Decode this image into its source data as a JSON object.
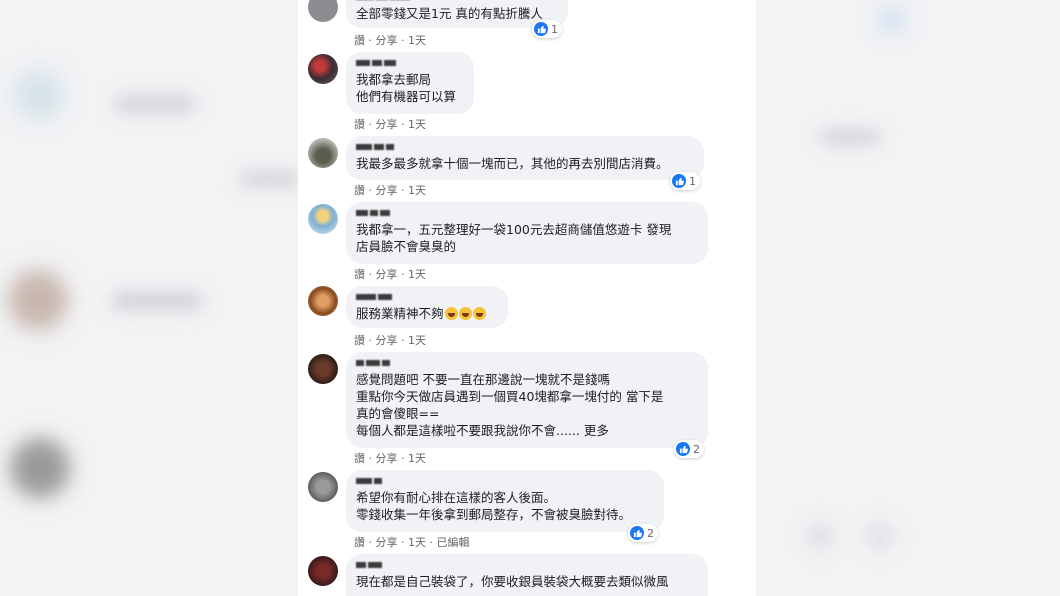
{
  "comments": [
    {
      "text": "全部零錢又是1元 真的有點折騰人",
      "meta": "讚 · 分享 · 1天",
      "reactions": "1"
    },
    {
      "text": "我都拿去郵局\n他們有機器可以算",
      "meta": "讚 · 分享 · 1天",
      "reactions": ""
    },
    {
      "text": "我最多最多就拿十個一塊而已，其他的再去別間店消費。",
      "meta": "讚 · 分享 · 1天",
      "reactions": "1"
    },
    {
      "text": "我都拿一，五元整理好一袋100元去超商儲值悠遊卡 發現\n店員臉不會臭臭的",
      "meta": "讚 · 分享 · 1天",
      "reactions": ""
    },
    {
      "text": "服務業精神不夠",
      "meta": "讚 · 分享 · 1天",
      "reactions": ""
    },
    {
      "text": "感覺問題吧 不要一直在那邊說一塊就不是錢嗎\n重點你今天做店員遇到一個買40塊都拿一塊付的 當下是\n真的會傻眼==\n每個人都是這樣啦不要跟我說你不會......",
      "more": "更多",
      "meta": "讚 · 分享 · 1天",
      "reactions": "2"
    },
    {
      "text": "希望你有耐心排在這樣的客人後面。\n零錢收集一年後拿到郵局整存，不會被臭臉對待。",
      "meta": "讚 · 分享 · 1天 · 已編輯",
      "reactions": "2"
    },
    {
      "text": "現在都是自己裝袋了，你要收銀員裝袋大概要去類似微風",
      "meta": "",
      "reactions": ""
    }
  ],
  "colors": {
    "like_blue": "#1877f2",
    "bubble_bg": "#f0f2f5",
    "meta_gray": "#65676b"
  },
  "icons": {
    "like": "thumbs-up-icon",
    "laugh": "crying-laughing-emoji-icon"
  }
}
